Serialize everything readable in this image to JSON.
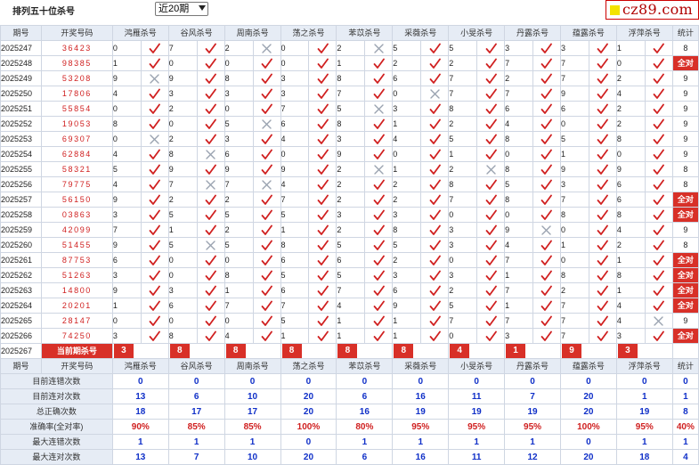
{
  "header": {
    "title": "排列五十位杀号",
    "select_value": "近20期",
    "logo_text": "cz89.com"
  },
  "columns": [
    "期号",
    "开奖号码",
    "鸿雁杀号",
    "谷风杀号",
    "周南杀号",
    "荡之杀号",
    "苯苡杀号",
    "采薇杀号",
    "小旻杀号",
    "丹露杀号",
    "蕴露杀号",
    "浮萍杀号",
    "统计"
  ],
  "rows": [
    {
      "period": "2025247",
      "draw": "36423",
      "picks": [
        [
          0,
          1
        ],
        [
          7,
          1
        ],
        [
          2,
          0
        ],
        [
          0,
          1
        ],
        [
          2,
          0
        ],
        [
          5,
          1
        ],
        [
          5,
          1
        ],
        [
          3,
          1
        ],
        [
          3,
          1
        ],
        [
          1,
          1
        ]
      ],
      "stat": "8"
    },
    {
      "period": "2025248",
      "draw": "98385",
      "picks": [
        [
          1,
          1
        ],
        [
          0,
          1
        ],
        [
          0,
          1
        ],
        [
          0,
          1
        ],
        [
          1,
          1
        ],
        [
          2,
          1
        ],
        [
          2,
          1
        ],
        [
          7,
          1
        ],
        [
          7,
          1
        ],
        [
          0,
          1
        ]
      ],
      "stat": "全对"
    },
    {
      "period": "2025249",
      "draw": "53208",
      "picks": [
        [
          9,
          0
        ],
        [
          9,
          1
        ],
        [
          8,
          1
        ],
        [
          3,
          1
        ],
        [
          8,
          1
        ],
        [
          6,
          1
        ],
        [
          7,
          1
        ],
        [
          2,
          1
        ],
        [
          7,
          1
        ],
        [
          2,
          1
        ]
      ],
      "stat": "9"
    },
    {
      "period": "2025250",
      "draw": "17806",
      "picks": [
        [
          4,
          1
        ],
        [
          3,
          1
        ],
        [
          3,
          1
        ],
        [
          3,
          1
        ],
        [
          7,
          1
        ],
        [
          0,
          0
        ],
        [
          7,
          1
        ],
        [
          7,
          1
        ],
        [
          9,
          1
        ],
        [
          4,
          1
        ]
      ],
      "stat": "9"
    },
    {
      "period": "2025251",
      "draw": "55854",
      "picks": [
        [
          0,
          1
        ],
        [
          2,
          1
        ],
        [
          0,
          1
        ],
        [
          7,
          1
        ],
        [
          5,
          0
        ],
        [
          3,
          1
        ],
        [
          8,
          1
        ],
        [
          6,
          1
        ],
        [
          6,
          1
        ],
        [
          2,
          1
        ]
      ],
      "stat": "9"
    },
    {
      "period": "2025252",
      "draw": "19053",
      "picks": [
        [
          8,
          1
        ],
        [
          0,
          1
        ],
        [
          5,
          0
        ],
        [
          6,
          1
        ],
        [
          8,
          1
        ],
        [
          1,
          1
        ],
        [
          2,
          1
        ],
        [
          4,
          1
        ],
        [
          0,
          1
        ],
        [
          2,
          1
        ]
      ],
      "stat": "9"
    },
    {
      "period": "2025253",
      "draw": "69307",
      "picks": [
        [
          0,
          0
        ],
        [
          2,
          1
        ],
        [
          3,
          1
        ],
        [
          4,
          1
        ],
        [
          3,
          1
        ],
        [
          4,
          1
        ],
        [
          5,
          1
        ],
        [
          8,
          1
        ],
        [
          5,
          1
        ],
        [
          8,
          1
        ]
      ],
      "stat": "9"
    },
    {
      "period": "2025254",
      "draw": "62884",
      "picks": [
        [
          4,
          1
        ],
        [
          8,
          0
        ],
        [
          6,
          1
        ],
        [
          0,
          1
        ],
        [
          9,
          1
        ],
        [
          0,
          1
        ],
        [
          1,
          1
        ],
        [
          0,
          1
        ],
        [
          1,
          1
        ],
        [
          0,
          1
        ]
      ],
      "stat": "9"
    },
    {
      "period": "2025255",
      "draw": "58321",
      "picks": [
        [
          5,
          1
        ],
        [
          9,
          1
        ],
        [
          9,
          1
        ],
        [
          9,
          1
        ],
        [
          2,
          0
        ],
        [
          1,
          1
        ],
        [
          2,
          0
        ],
        [
          8,
          1
        ],
        [
          9,
          1
        ],
        [
          9,
          1
        ]
      ],
      "stat": "8"
    },
    {
      "period": "2025256",
      "draw": "79775",
      "picks": [
        [
          4,
          1
        ],
        [
          7,
          0
        ],
        [
          7,
          0
        ],
        [
          4,
          1
        ],
        [
          2,
          1
        ],
        [
          2,
          1
        ],
        [
          8,
          1
        ],
        [
          5,
          1
        ],
        [
          3,
          1
        ],
        [
          6,
          1
        ]
      ],
      "stat": "8"
    },
    {
      "period": "2025257",
      "draw": "56150",
      "picks": [
        [
          9,
          1
        ],
        [
          2,
          1
        ],
        [
          2,
          1
        ],
        [
          7,
          1
        ],
        [
          2,
          1
        ],
        [
          2,
          1
        ],
        [
          7,
          1
        ],
        [
          8,
          1
        ],
        [
          7,
          1
        ],
        [
          6,
          1
        ]
      ],
      "stat": "全对"
    },
    {
      "period": "2025258",
      "draw": "03863",
      "picks": [
        [
          3,
          1
        ],
        [
          5,
          1
        ],
        [
          5,
          1
        ],
        [
          5,
          1
        ],
        [
          3,
          1
        ],
        [
          3,
          1
        ],
        [
          0,
          1
        ],
        [
          0,
          1
        ],
        [
          8,
          1
        ],
        [
          8,
          1
        ]
      ],
      "stat": "全对"
    },
    {
      "period": "2025259",
      "draw": "42099",
      "picks": [
        [
          7,
          1
        ],
        [
          1,
          1
        ],
        [
          2,
          1
        ],
        [
          1,
          1
        ],
        [
          2,
          1
        ],
        [
          8,
          1
        ],
        [
          3,
          1
        ],
        [
          9,
          0
        ],
        [
          0,
          1
        ],
        [
          4,
          1
        ]
      ],
      "stat": "9"
    },
    {
      "period": "2025260",
      "draw": "51455",
      "picks": [
        [
          9,
          1
        ],
        [
          5,
          0
        ],
        [
          5,
          1
        ],
        [
          8,
          1
        ],
        [
          5,
          1
        ],
        [
          5,
          1
        ],
        [
          3,
          1
        ],
        [
          4,
          1
        ],
        [
          1,
          1
        ],
        [
          2,
          1
        ]
      ],
      "stat": "8"
    },
    {
      "period": "2025261",
      "draw": "87753",
      "picks": [
        [
          6,
          1
        ],
        [
          0,
          1
        ],
        [
          0,
          1
        ],
        [
          6,
          1
        ],
        [
          6,
          1
        ],
        [
          2,
          1
        ],
        [
          0,
          1
        ],
        [
          7,
          1
        ],
        [
          0,
          1
        ],
        [
          1,
          1
        ]
      ],
      "stat": "全对"
    },
    {
      "period": "2025262",
      "draw": "51263",
      "picks": [
        [
          3,
          1
        ],
        [
          0,
          1
        ],
        [
          8,
          1
        ],
        [
          5,
          1
        ],
        [
          5,
          1
        ],
        [
          3,
          1
        ],
        [
          3,
          1
        ],
        [
          1,
          1
        ],
        [
          8,
          1
        ],
        [
          8,
          1
        ]
      ],
      "stat": "全对"
    },
    {
      "period": "2025263",
      "draw": "14800",
      "picks": [
        [
          9,
          1
        ],
        [
          3,
          1
        ],
        [
          1,
          1
        ],
        [
          6,
          1
        ],
        [
          7,
          1
        ],
        [
          6,
          1
        ],
        [
          2,
          1
        ],
        [
          7,
          1
        ],
        [
          2,
          1
        ],
        [
          1,
          1
        ]
      ],
      "stat": "全对"
    },
    {
      "period": "2025264",
      "draw": "20201",
      "picks": [
        [
          1,
          1
        ],
        [
          6,
          1
        ],
        [
          7,
          1
        ],
        [
          7,
          1
        ],
        [
          4,
          1
        ],
        [
          9,
          1
        ],
        [
          5,
          1
        ],
        [
          1,
          1
        ],
        [
          7,
          1
        ],
        [
          4,
          1
        ]
      ],
      "stat": "全对"
    },
    {
      "period": "2025265",
      "draw": "28147",
      "picks": [
        [
          0,
          1
        ],
        [
          0,
          1
        ],
        [
          0,
          1
        ],
        [
          5,
          1
        ],
        [
          1,
          1
        ],
        [
          1,
          1
        ],
        [
          7,
          1
        ],
        [
          7,
          1
        ],
        [
          7,
          1
        ],
        [
          4,
          0
        ]
      ],
      "stat": "9"
    },
    {
      "period": "2025266",
      "draw": "74250",
      "picks": [
        [
          3,
          1
        ],
        [
          8,
          1
        ],
        [
          4,
          1
        ],
        [
          1,
          1
        ],
        [
          1,
          1
        ],
        [
          1,
          1
        ],
        [
          0,
          1
        ],
        [
          3,
          1
        ],
        [
          7,
          1
        ],
        [
          3,
          1
        ]
      ],
      "stat": "全对"
    }
  ],
  "current": {
    "period": "2025267",
    "label": "当前期杀号",
    "picks": [
      "3",
      "8",
      "8",
      "8",
      "8",
      "8",
      "4",
      "1",
      "9",
      "3"
    ]
  },
  "summary": {
    "header": [
      "期号",
      "开奖号码",
      "鸿雁杀号",
      "谷风杀号",
      "周南杀号",
      "荡之杀号",
      "苯苡杀号",
      "采薇杀号",
      "小旻杀号",
      "丹露杀号",
      "蕴露杀号",
      "浮萍杀号",
      "统计"
    ],
    "rows": [
      {
        "label": "目前连错次数",
        "values": [
          "0",
          "0",
          "0",
          "0",
          "0",
          "0",
          "0",
          "0",
          "0",
          "0",
          "0"
        ],
        "pct": false
      },
      {
        "label": "目前连对次数",
        "values": [
          "13",
          "6",
          "10",
          "20",
          "6",
          "16",
          "11",
          "7",
          "20",
          "1",
          "1"
        ],
        "pct": false
      },
      {
        "label": "总正确次数",
        "values": [
          "18",
          "17",
          "17",
          "20",
          "16",
          "19",
          "19",
          "19",
          "20",
          "19",
          "8"
        ],
        "pct": false
      },
      {
        "label": "准确率(全对率)",
        "values": [
          "90%",
          "85%",
          "85%",
          "100%",
          "80%",
          "95%",
          "95%",
          "95%",
          "100%",
          "95%",
          "40%"
        ],
        "pct": true
      },
      {
        "label": "最大连错次数",
        "values": [
          "1",
          "1",
          "1",
          "0",
          "1",
          "1",
          "1",
          "1",
          "0",
          "1",
          "1"
        ],
        "pct": false
      },
      {
        "label": "最大连对次数",
        "values": [
          "13",
          "7",
          "10",
          "20",
          "6",
          "16",
          "11",
          "12",
          "20",
          "18",
          "4"
        ],
        "pct": false
      }
    ]
  },
  "colors": {
    "accent": "#d83028",
    "header_bg": "#e6ecf5",
    "tick": "#d02020",
    "cross": "#9aa3b0",
    "number_blue": "#1030c8"
  }
}
